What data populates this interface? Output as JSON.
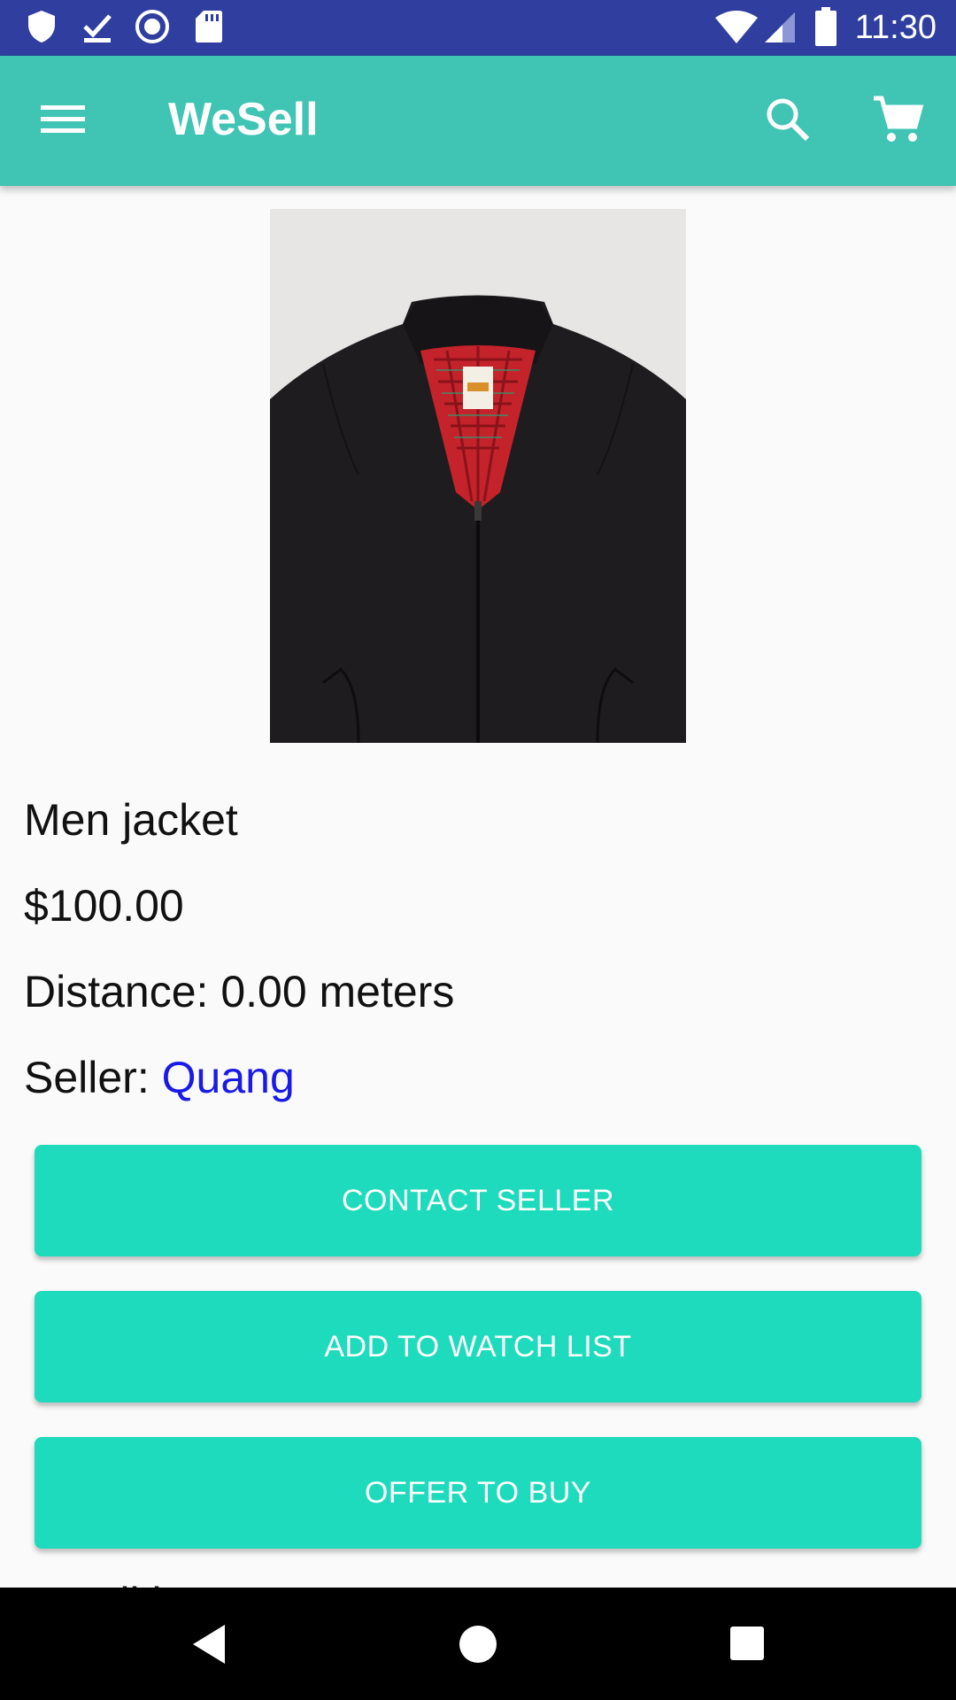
{
  "status_bar": {
    "time": "11:30",
    "icons": [
      "shield-icon",
      "download-done-icon",
      "record-icon",
      "sd-card-icon",
      "wifi-icon",
      "cell-signal-icon",
      "battery-icon"
    ]
  },
  "app_bar": {
    "title": "WeSell",
    "icons": [
      "menu-icon",
      "search-icon",
      "cart-icon"
    ],
    "color": "#40C4B4"
  },
  "product": {
    "image_name": "jacket-image",
    "name": "Men jacket",
    "price": "$100.00",
    "distance": "Distance: 0.00 meters",
    "seller_label": "Seller: ",
    "seller_name": "Quang",
    "partial_text": "Condition: N"
  },
  "buttons": {
    "contact_seller": "CONTACT SELLER",
    "add_to_watch_list": "ADD TO WATCH LIST",
    "offer_to_buy": "OFFER TO BUY",
    "color": "#1DDBBC"
  },
  "nav_bar": {
    "icons": [
      "back-icon",
      "home-icon",
      "recents-icon"
    ]
  }
}
